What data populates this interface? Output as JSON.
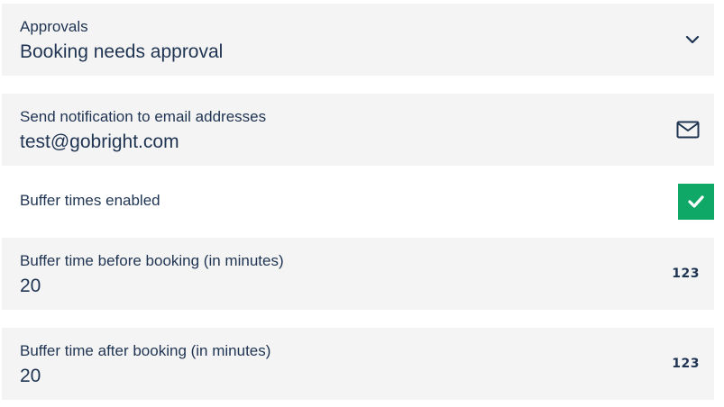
{
  "approvals": {
    "label": "Approvals",
    "value": "Booking needs approval",
    "icon": "chevron-down-icon"
  },
  "notification": {
    "label": "Send notification to email addresses",
    "value": "test@gobright.com",
    "icon": "mail-icon"
  },
  "buffer_enabled": {
    "label": "Buffer times enabled",
    "checked": true,
    "color": "#0fa866"
  },
  "buffer_before": {
    "label": "Buffer time before booking (in minutes)",
    "value": "20",
    "icon_text": "123"
  },
  "buffer_after": {
    "label": "Buffer time after booking (in minutes)",
    "value": "20",
    "icon_text": "123"
  }
}
